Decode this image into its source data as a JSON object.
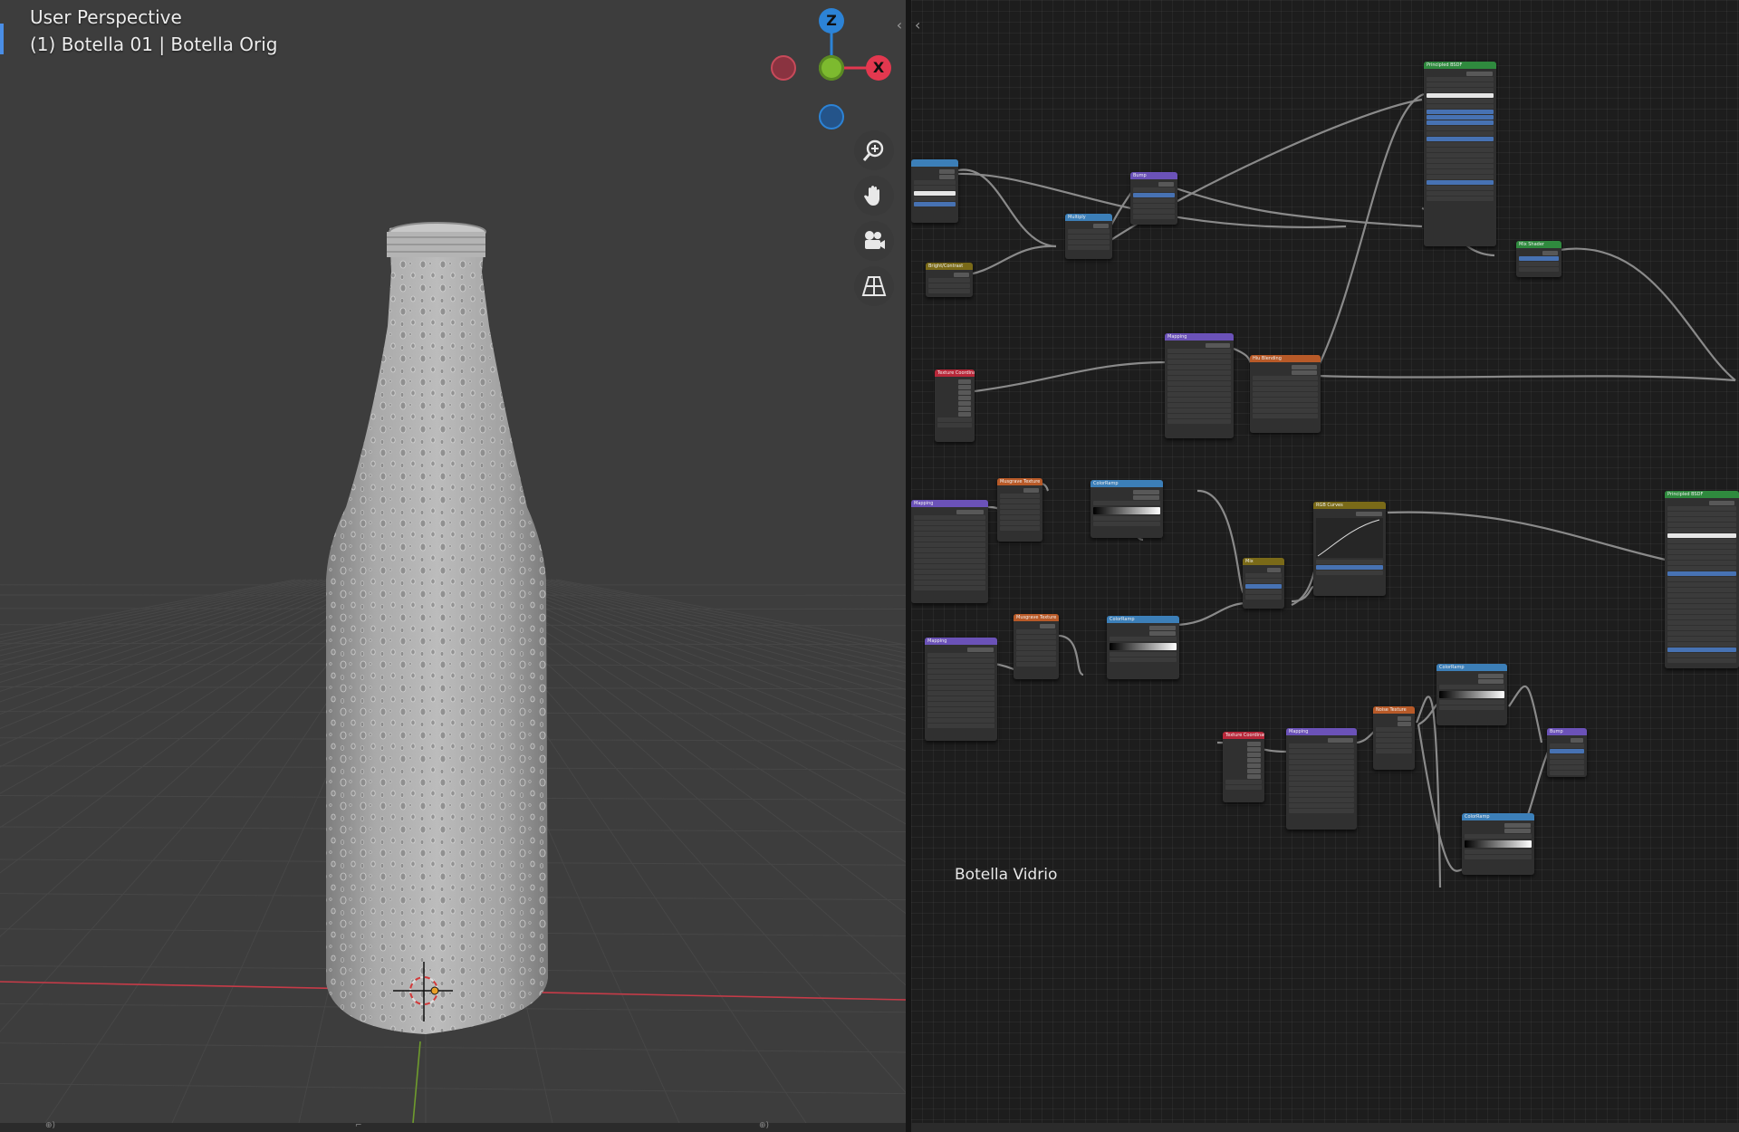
{
  "viewport": {
    "view_label": "User Perspective",
    "object_label": "(1) Botella 01 | Botella Orig",
    "gizmo": {
      "z_label": "Z",
      "x_label": "X"
    },
    "nav_tools": [
      {
        "name": "zoom",
        "icon": "zoom-icon"
      },
      {
        "name": "pan",
        "icon": "hand-icon"
      },
      {
        "name": "camera",
        "icon": "camera-icon"
      },
      {
        "name": "ortho",
        "icon": "grid-perspective-icon"
      }
    ],
    "footer": [
      "⊕)",
      "⌐",
      "⊕)"
    ]
  },
  "node_editor": {
    "frame_label": "Botella Vidrio",
    "nodes": [
      {
        "id": "img-tex",
        "title": "",
        "color": "#3c7fb8",
        "rows": [
          "out",
          "out",
          "dim",
          "dim",
          "white",
          "dim",
          "acc"
        ]
      },
      {
        "id": "bright",
        "title": "Bright/Contrast",
        "color": "#7a6a18",
        "rows": [
          "out",
          "dim",
          "dim",
          "dim"
        ]
      },
      {
        "id": "multiply",
        "title": "Multiply",
        "color": "#3c7fb8",
        "rows": [
          "out",
          "dim",
          "dim",
          "dim",
          "dim"
        ]
      },
      {
        "id": "bump1",
        "title": "Bump",
        "color": "#6b52b8",
        "rows": [
          "out",
          "dim",
          "acc",
          "dim",
          "dim",
          "dim",
          "dim"
        ]
      },
      {
        "id": "pbsdf1",
        "title": "Principled BSDF",
        "color": "#2f8a3e",
        "rows": [
          "out",
          "dim",
          "dim",
          "dim",
          "white",
          "dim",
          "dim",
          "acc",
          "acc",
          "acc",
          "dim",
          "dim",
          "acc",
          "dim",
          "dim",
          "dim",
          "dim",
          "dim",
          "dim",
          "dim",
          "acc",
          "dim",
          "dim",
          "dim"
        ]
      },
      {
        "id": "mixshader",
        "title": "Mix Shader",
        "color": "#2f8a3e",
        "rows": [
          "out",
          "acc",
          "dim",
          "dim"
        ]
      },
      {
        "id": "texcoord1",
        "title": "Texture Coordinat",
        "color": "#b8283a",
        "rows": [
          "out",
          "out",
          "out",
          "out",
          "out",
          "out",
          "out",
          "dim",
          "dim"
        ]
      },
      {
        "id": "mapping1",
        "title": "Mapping",
        "color": "#6b52b8",
        "rows": [
          "out",
          "dim",
          "dim",
          "dim",
          "dim",
          "dim",
          "dim",
          "dim",
          "dim",
          "dim",
          "dim",
          "dim",
          "dim",
          "dim",
          "dim"
        ]
      },
      {
        "id": "imgtex2",
        "title": "Hiu Blending",
        "color": "#b85a28",
        "rows": [
          "out",
          "out",
          "dim",
          "dim",
          "dim",
          "dim",
          "dim",
          "dim",
          "dim",
          "dim"
        ]
      },
      {
        "id": "mapping2",
        "title": "Mapping",
        "color": "#6b52b8",
        "rows": [
          "out",
          "dim",
          "dim",
          "dim",
          "dim",
          "dim",
          "dim",
          "dim",
          "dim",
          "dim",
          "dim",
          "dim",
          "dim",
          "dim",
          "dim"
        ]
      },
      {
        "id": "musgrave1",
        "title": "Musgrave Texture",
        "color": "#b85a28",
        "rows": [
          "out",
          "dim",
          "dim",
          "dim",
          "dim",
          "dim",
          "dim",
          "dim"
        ]
      },
      {
        "id": "ramp1",
        "title": "ColorRamp",
        "color": "#3c7fb8",
        "rows": [
          "out",
          "out",
          "dim",
          "ramp",
          "dim",
          "dim"
        ]
      },
      {
        "id": "mix1",
        "title": "Mix",
        "color": "#7a6a18",
        "rows": [
          "out",
          "dim",
          "dim",
          "acc",
          "dim",
          "dim"
        ]
      },
      {
        "id": "curves",
        "title": "RGB Curves",
        "color": "#7a6a18",
        "rows": [
          "out",
          "curve",
          "dim",
          "acc",
          "dim"
        ]
      },
      {
        "id": "pbsdf2",
        "title": "Principled BSDF",
        "color": "#2f8a3e",
        "rows": [
          "out",
          "dim",
          "dim",
          "dim",
          "dim",
          "dim",
          "white",
          "dim",
          "dim",
          "dim",
          "dim",
          "dim",
          "dim",
          "acc",
          "dim",
          "dim",
          "dim",
          "dim",
          "dim",
          "dim",
          "dim",
          "dim",
          "dim",
          "dim",
          "dim",
          "dim",
          "dim",
          "acc",
          "dim",
          "dim"
        ]
      },
      {
        "id": "mapping3",
        "title": "Mapping",
        "color": "#6b52b8",
        "rows": [
          "out",
          "dim",
          "dim",
          "dim",
          "dim",
          "dim",
          "dim",
          "dim",
          "dim",
          "dim",
          "dim",
          "dim",
          "dim",
          "dim",
          "dim"
        ]
      },
      {
        "id": "musgrave2",
        "title": "Musgrave Texture",
        "color": "#b85a28",
        "rows": [
          "out",
          "dim",
          "dim",
          "dim",
          "dim",
          "dim",
          "dim",
          "dim"
        ]
      },
      {
        "id": "ramp2",
        "title": "ColorRamp",
        "color": "#3c7fb8",
        "rows": [
          "out",
          "out",
          "dim",
          "ramp",
          "dim",
          "dim"
        ]
      },
      {
        "id": "texcoord2",
        "title": "Texture Coordinat",
        "color": "#b8283a",
        "rows": [
          "out",
          "out",
          "out",
          "out",
          "out",
          "out",
          "out",
          "dim",
          "dim"
        ]
      },
      {
        "id": "mapping4",
        "title": "Mapping",
        "color": "#6b52b8",
        "rows": [
          "out",
          "dim",
          "dim",
          "dim",
          "dim",
          "dim",
          "dim",
          "dim",
          "dim",
          "dim",
          "dim",
          "dim",
          "dim",
          "dim"
        ]
      },
      {
        "id": "noise",
        "title": "Noise Texture",
        "color": "#b85a28",
        "rows": [
          "out",
          "out",
          "dim",
          "dim",
          "dim",
          "dim",
          "dim"
        ]
      },
      {
        "id": "ramp3",
        "title": "ColorRamp",
        "color": "#3c7fb8",
        "rows": [
          "out",
          "out",
          "dim",
          "ramp",
          "dim",
          "dim"
        ]
      },
      {
        "id": "ramp4",
        "title": "ColorRamp",
        "color": "#3c7fb8",
        "rows": [
          "out",
          "out",
          "dim",
          "ramp",
          "dim",
          "dim"
        ]
      },
      {
        "id": "bump2",
        "title": "Bump",
        "color": "#6b52b8",
        "rows": [
          "out",
          "dim",
          "acc",
          "dim",
          "dim",
          "dim",
          "dim"
        ]
      }
    ]
  },
  "colors": {
    "viewport_bg": "#3d3d3d",
    "grid_line": "#474747",
    "axis_x": "#c63b48",
    "axis_y": "#6e9b2d",
    "gizmo_x": "#e3384f",
    "gizmo_y": "#7dba2f",
    "gizmo_z": "#2c83d6",
    "node_editor_bg": "#1d1d1d",
    "wire": "#8a8a8a"
  }
}
